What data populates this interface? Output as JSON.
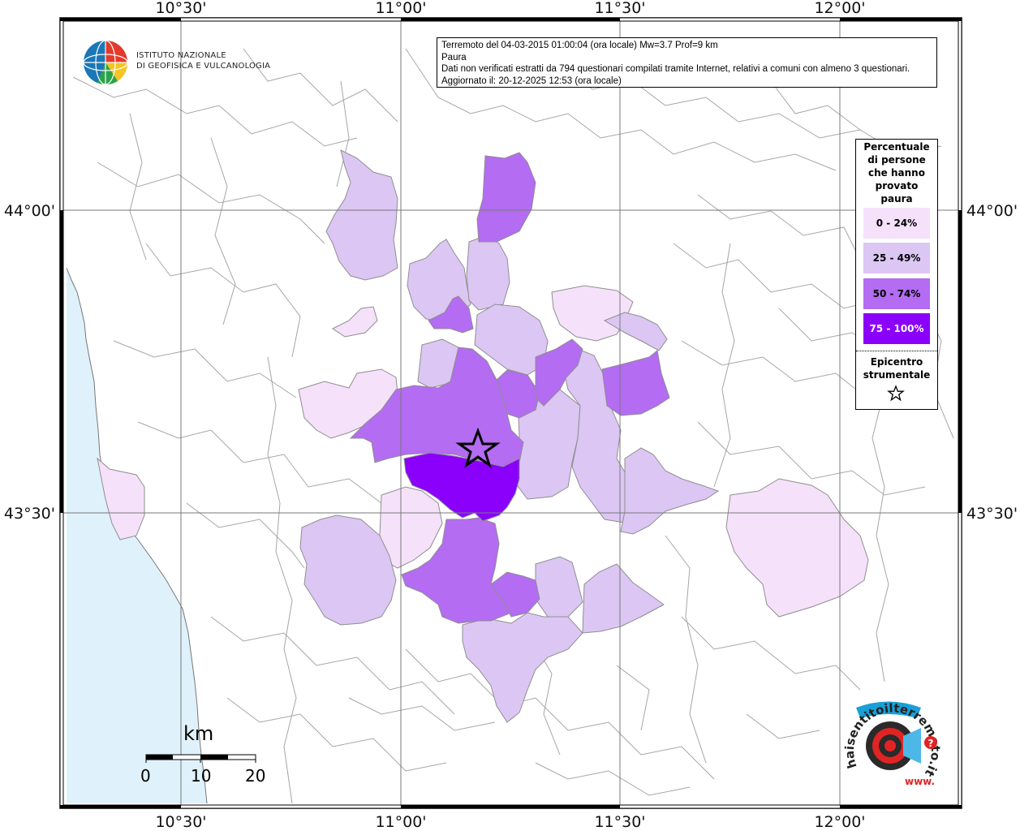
{
  "map": {
    "lon_ticks": [
      "10°30'",
      "11°00'",
      "11°30'",
      "12°00'"
    ],
    "lat_ticks": [
      "44°00'",
      "43°30'"
    ],
    "colors": {
      "sea": "#dff1fb",
      "land": "#ffffff",
      "border": "#9a9a9a",
      "class_0_24": "#f5e1fa",
      "class_25_49": "#dcc6f4",
      "class_50_74": "#b36cf2",
      "class_75_100": "#8a00fb"
    }
  },
  "info": {
    "line1": "Terremoto del 04-03-2015 01:00:04 (ora locale) Mw=3.7 Prof=9 km",
    "line2": "Paura",
    "line3": "Dati non verificati estratti da 794 questionari compilati tramite Internet, relativi a comuni con almeno 3 questionari.",
    "line4": "Aggiornato il: 20-12-2025 12:53 (ora locale)"
  },
  "ingv_logo": {
    "line1": "ISTITUTO NAZIONALE",
    "line2": "DI GEOFISICA E VULCANOLOGIA"
  },
  "legend": {
    "title": [
      "Percentuale",
      "di persone",
      "che hanno",
      "provato",
      "paura"
    ],
    "classes": [
      {
        "label": "0 - 24%",
        "color": "#f5e1fa"
      },
      {
        "label": "25 - 49%",
        "color": "#dcc6f4"
      },
      {
        "label": "50 - 74%",
        "color": "#b36cf2"
      },
      {
        "label": "75 - 100%",
        "color": "#8a00fb"
      }
    ],
    "epicenter": [
      "Epicentro",
      "strumentale"
    ],
    "epicenter_icon": "star-icon"
  },
  "scale": {
    "unit": "km",
    "labels": [
      "0",
      "10",
      "20"
    ]
  },
  "hsit_logo": {
    "text_arc": "haisentitoilterremoto.it",
    "text_url": "www.",
    "question_mark": "?"
  }
}
